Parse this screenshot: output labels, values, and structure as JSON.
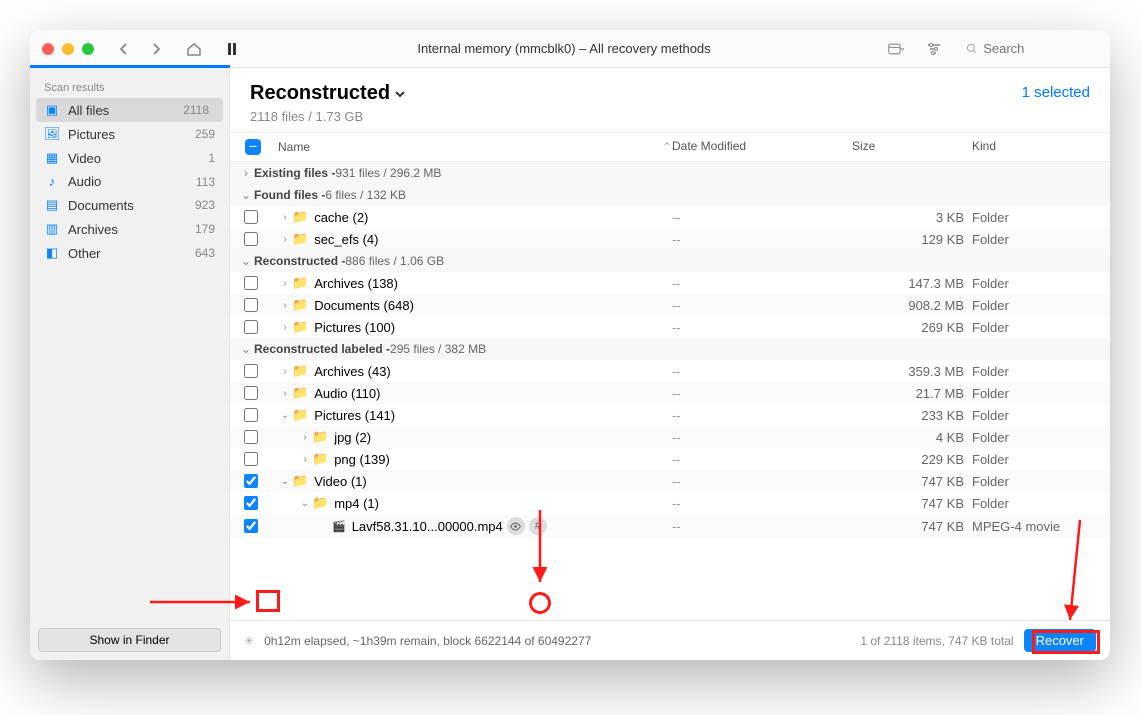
{
  "title": "Internal memory (mmcblk0) – All recovery methods",
  "search_placeholder": "Search",
  "sidebar": {
    "header": "Scan results",
    "items": [
      {
        "label": "All files",
        "count": "2118"
      },
      {
        "label": "Pictures",
        "count": "259"
      },
      {
        "label": "Video",
        "count": "1"
      },
      {
        "label": "Audio",
        "count": "113"
      },
      {
        "label": "Documents",
        "count": "923"
      },
      {
        "label": "Archives",
        "count": "179"
      },
      {
        "label": "Other",
        "count": "643"
      }
    ],
    "finder_btn": "Show in Finder"
  },
  "main": {
    "heading": "Reconstructed",
    "subheading": "2118 files / 1.73 GB",
    "selected": "1 selected",
    "cols": {
      "name": "Name",
      "date": "Date Modified",
      "size": "Size",
      "kind": "Kind"
    }
  },
  "sections": {
    "existing": "Existing files -",
    "existing_meta": " 931 files / 296.2 MB",
    "found": "Found files -",
    "found_meta": " 6 files / 132 KB",
    "recon": "Reconstructed -",
    "recon_meta": " 886 files / 1.06 GB",
    "reconlbl": "Reconstructed labeled -",
    "reconlbl_meta": " 295 files / 382 MB"
  },
  "rows": {
    "cache": {
      "name": "cache (2)",
      "size": "3 KB",
      "kind": "Folder"
    },
    "secefs": {
      "name": "sec_efs (4)",
      "size": "129 KB",
      "kind": "Folder"
    },
    "arch138": {
      "name": "Archives (138)",
      "size": "147.3 MB",
      "kind": "Folder"
    },
    "doc648": {
      "name": "Documents (648)",
      "size": "908.2 MB",
      "kind": "Folder"
    },
    "pic100": {
      "name": "Pictures (100)",
      "size": "269 KB",
      "kind": "Folder"
    },
    "arch43": {
      "name": "Archives (43)",
      "size": "359.3 MB",
      "kind": "Folder"
    },
    "aud110": {
      "name": "Audio (110)",
      "size": "21.7 MB",
      "kind": "Folder"
    },
    "pic141": {
      "name": "Pictures (141)",
      "size": "233 KB",
      "kind": "Folder"
    },
    "jpg2": {
      "name": "jpg (2)",
      "size": "4 KB",
      "kind": "Folder"
    },
    "png139": {
      "name": "png (139)",
      "size": "229 KB",
      "kind": "Folder"
    },
    "vid1": {
      "name": "Video (1)",
      "size": "747 KB",
      "kind": "Folder"
    },
    "mp41": {
      "name": "mp4 (1)",
      "size": "747 KB",
      "kind": "Folder"
    },
    "file": {
      "name": "Lavf58.31.10...00000.mp4",
      "size": "747 KB",
      "kind": "MPEG-4 movie"
    }
  },
  "dash": "--",
  "footer": {
    "status": "0h12m elapsed, ~1h39m remain, block 6622144 of 60492277",
    "right": "1 of 2118 items, 747 KB total",
    "recover": "Recover"
  }
}
